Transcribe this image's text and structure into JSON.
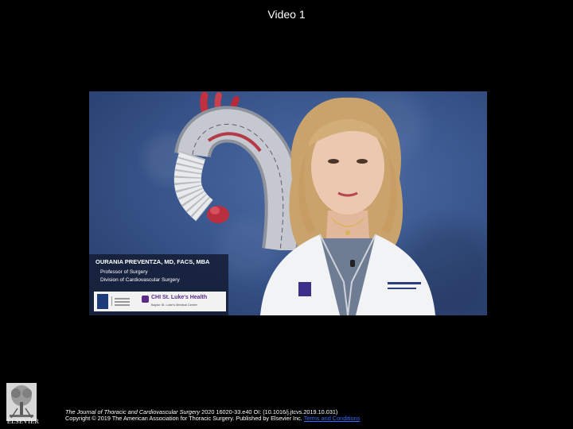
{
  "slide": {
    "title": "Video 1"
  },
  "video": {
    "lower_third": {
      "name": "OURANIA PREVENTZA, MD, FACS, MBA",
      "title_line_1": "Professor of Surgery",
      "title_line_2": "Division of Cardiovascular Surgery",
      "partner_logo_text": "CHI St. Luke's Health",
      "partner_logo_subtext": "Baylor St. Luke's Medical Center"
    }
  },
  "footer": {
    "publisher_name": "ELSEVIER",
    "journal": "The Journal of Thoracic and Cardiovascular Surgery",
    "citation_rest": " 2020 16020-33.e40 OI: (10.1016/j.jtcvs.2019.10.031)",
    "copyright": "Copyright © 2019 The American Association for Thoracic Surgery",
    "copyright_tail": ". Published by Elsevier Inc. ",
    "terms_link": "Terms and Conditions"
  },
  "colors": {
    "background": "#000000",
    "video_blue": "#3a578e",
    "link": "#2f6bff",
    "chi_purple": "#5b2a86"
  }
}
